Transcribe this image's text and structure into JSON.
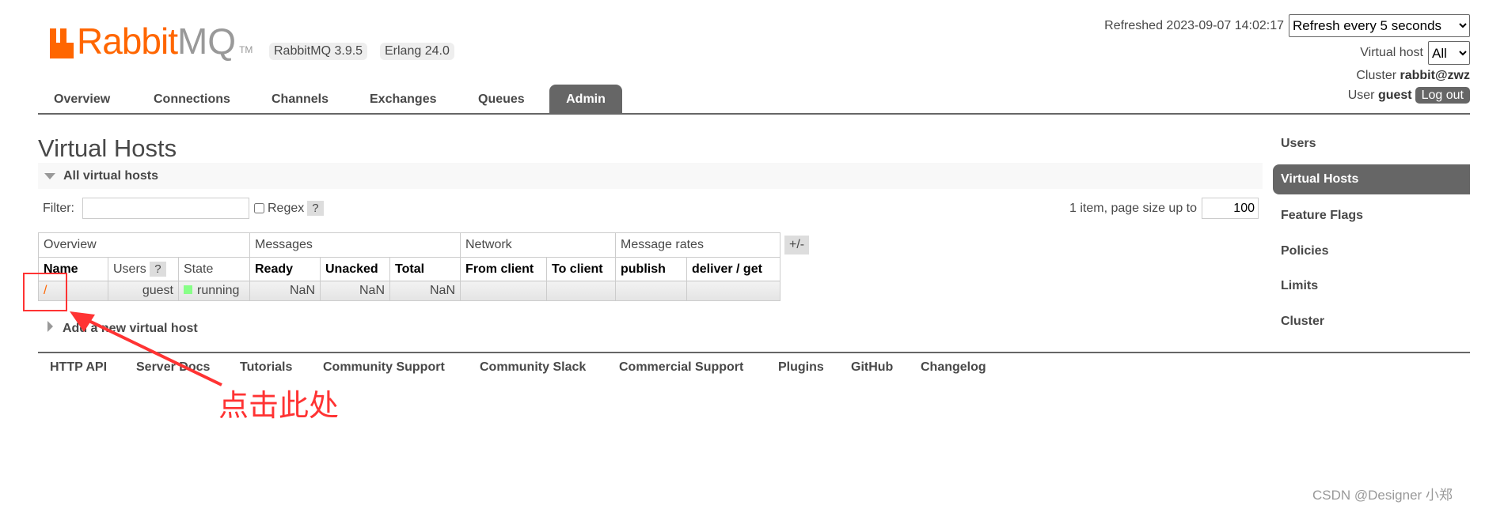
{
  "brand": {
    "logo_text_orange": "Rabbit",
    "logo_text_gray": "MQ",
    "tm": "TM",
    "version": "RabbitMQ 3.9.5",
    "erlang": "Erlang 24.0",
    "accent": "#ff6600"
  },
  "nav": {
    "tabs": [
      "Overview",
      "Connections",
      "Channels",
      "Exchanges",
      "Queues",
      "Admin"
    ],
    "active": "Admin"
  },
  "status": {
    "refreshed": "Refreshed 2023-09-07 14:02:17",
    "refresh_option": "Refresh every 5 seconds",
    "vhost_label": "Virtual host",
    "vhost_value": "All",
    "cluster_label": "Cluster",
    "cluster_value": "rabbit@zwz",
    "user_label": "User",
    "user_value": "guest",
    "logout": "Log out"
  },
  "page": {
    "title": "Virtual Hosts",
    "section": "All virtual hosts",
    "filter_label": "Filter:",
    "filter_value": "",
    "regex_label": "Regex",
    "help": "?",
    "paging": "1 item, page size up to",
    "page_size": "100",
    "plus_minus": "+/-",
    "add_vhost": "Add a new virtual host"
  },
  "table": {
    "groups": [
      "Overview",
      "Messages",
      "Network",
      "Message rates"
    ],
    "headers": [
      "Name",
      "Users",
      "State",
      "Ready",
      "Unacked",
      "Total",
      "From client",
      "To client",
      "publish",
      "deliver / get"
    ],
    "rows": [
      {
        "name": "/",
        "users": "guest",
        "state": "running",
        "ready": "NaN",
        "unacked": "NaN",
        "total": "NaN",
        "from_client": "",
        "to_client": "",
        "publish": "",
        "deliver_get": ""
      }
    ]
  },
  "sidebar": {
    "items": [
      "Users",
      "Virtual Hosts",
      "Feature Flags",
      "Policies",
      "Limits",
      "Cluster"
    ],
    "active": "Virtual Hosts"
  },
  "footer": {
    "links": [
      "HTTP API",
      "Server Docs",
      "Tutorials",
      "Community Support",
      "Community Slack",
      "Commercial Support",
      "Plugins",
      "GitHub",
      "Changelog"
    ]
  },
  "annotation": {
    "note": "点击此处",
    "color": "#ff3333"
  },
  "watermark": "CSDN @Designer 小郑"
}
